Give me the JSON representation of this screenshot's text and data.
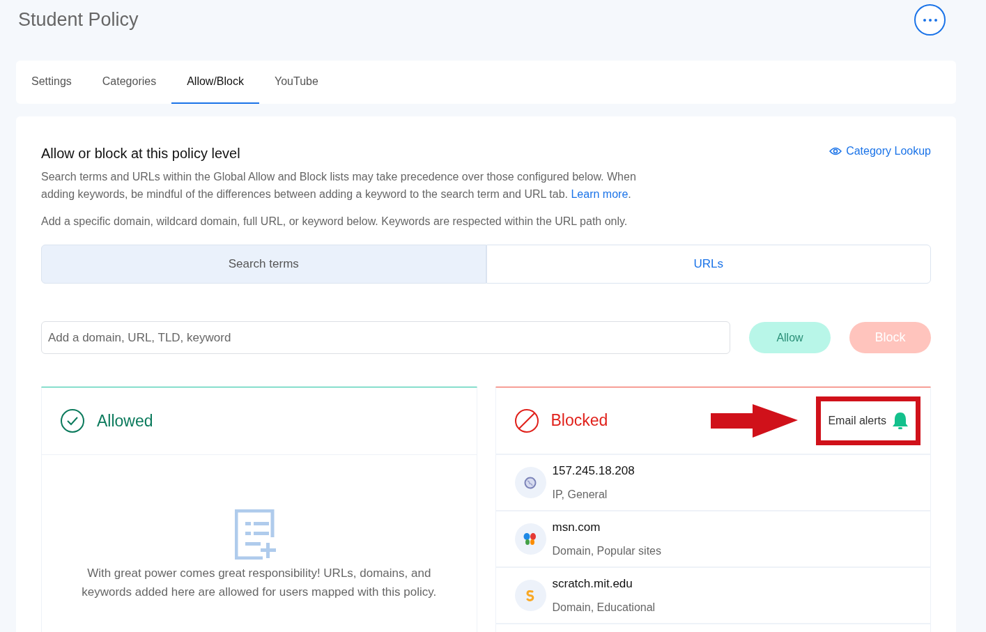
{
  "page": {
    "title": "Student Policy"
  },
  "tabs": [
    {
      "label": "Settings",
      "selected": false
    },
    {
      "label": "Categories",
      "selected": false
    },
    {
      "label": "Allow/Block",
      "selected": true
    },
    {
      "label": "YouTube",
      "selected": false
    }
  ],
  "section": {
    "heading": "Allow or block at this policy level",
    "lookup_link": "Category Lookup",
    "description": "Search terms and URLs within the Global Allow and Block lists may take precedence over those configured below. When adding keywords, be mindful of the differences between adding a keyword to the search term and URL tab.",
    "learn_more": "Learn more",
    "after_link": ".",
    "hint": "Add a specific domain, wildcard domain, full URL, or keyword below. Keywords are respected within the URL path only."
  },
  "mode_tabs": [
    {
      "label": "Search terms",
      "selected": true
    },
    {
      "label": "URLs",
      "selected": false
    }
  ],
  "entry": {
    "placeholder": "Add a domain, URL, TLD, keyword"
  },
  "actions": [
    {
      "kind": "allow",
      "label": "Allow",
      "disabled": true
    },
    {
      "kind": "block",
      "label": "Block",
      "disabled": true
    }
  ],
  "allowed": {
    "title": "Allowed",
    "empty_text": "With great power comes great responsibility! URLs, domains, and keywords added here are allowed for users mapped with this policy."
  },
  "blocked": {
    "title": "Blocked",
    "email_alerts": "Email alerts",
    "highlighted": true,
    "items": [
      {
        "kind": "globe",
        "name": "157.245.18.208",
        "detail": "IP, General"
      },
      {
        "kind": "butterfly",
        "name": "msn.com",
        "detail": "Domain, Popular sites"
      },
      {
        "kind": "scratch",
        "name": "scratch.mit.edu",
        "detail": "Domain, Educational"
      }
    ]
  }
}
